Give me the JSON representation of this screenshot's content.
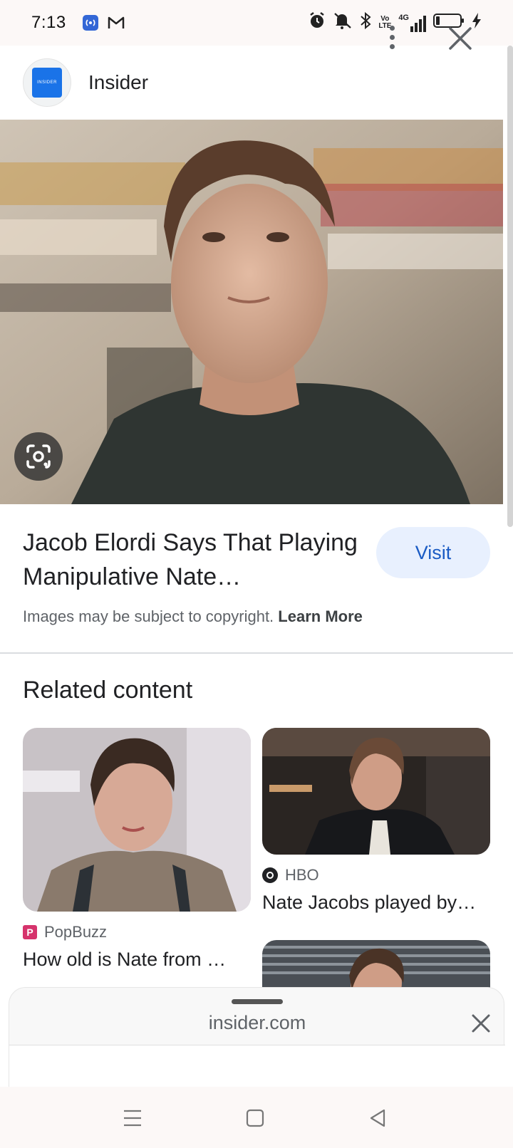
{
  "status_bar": {
    "time": "7:13",
    "icons": [
      "hotspot-icon",
      "gmail-icon",
      "alarm-icon",
      "mute-icon",
      "bluetooth-icon",
      "volte-icon",
      "signal-4g-icon",
      "battery-icon",
      "charging-icon"
    ],
    "volte_label": "Vo LTE",
    "network_label": "4G"
  },
  "header": {
    "site_logo_text": "INSIDER",
    "site_name": "Insider",
    "more_icon": "more-vert-icon",
    "close_icon": "close-icon"
  },
  "hero": {
    "lens_icon": "google-lens-icon"
  },
  "result": {
    "title": "Jacob Elordi Says That Playing Manipulative Nate…",
    "visit_label": "Visit",
    "copyright_text": "Images may be subject to copyright.",
    "learn_more_label": "Learn More"
  },
  "related": {
    "heading": "Related content",
    "items": [
      {
        "source": "PopBuzz",
        "title": "How old is Nate from …",
        "source_icon": "popbuzz-logo-icon"
      },
      {
        "source": "HBO",
        "title": "Nate Jacobs played by…",
        "source_icon": "hbo-logo-icon"
      }
    ]
  },
  "sheet": {
    "url": "insider.com",
    "close_icon": "close-icon"
  },
  "nav_bar": {
    "menu_icon": "menu-icon",
    "home_icon": "home-square-icon",
    "back_icon": "back-triangle-icon"
  },
  "colors": {
    "accent": "#1a73e8",
    "visit_bg": "#e8f0fe",
    "visit_text": "#1a5bc4",
    "popbuzz": "#d6336c"
  }
}
